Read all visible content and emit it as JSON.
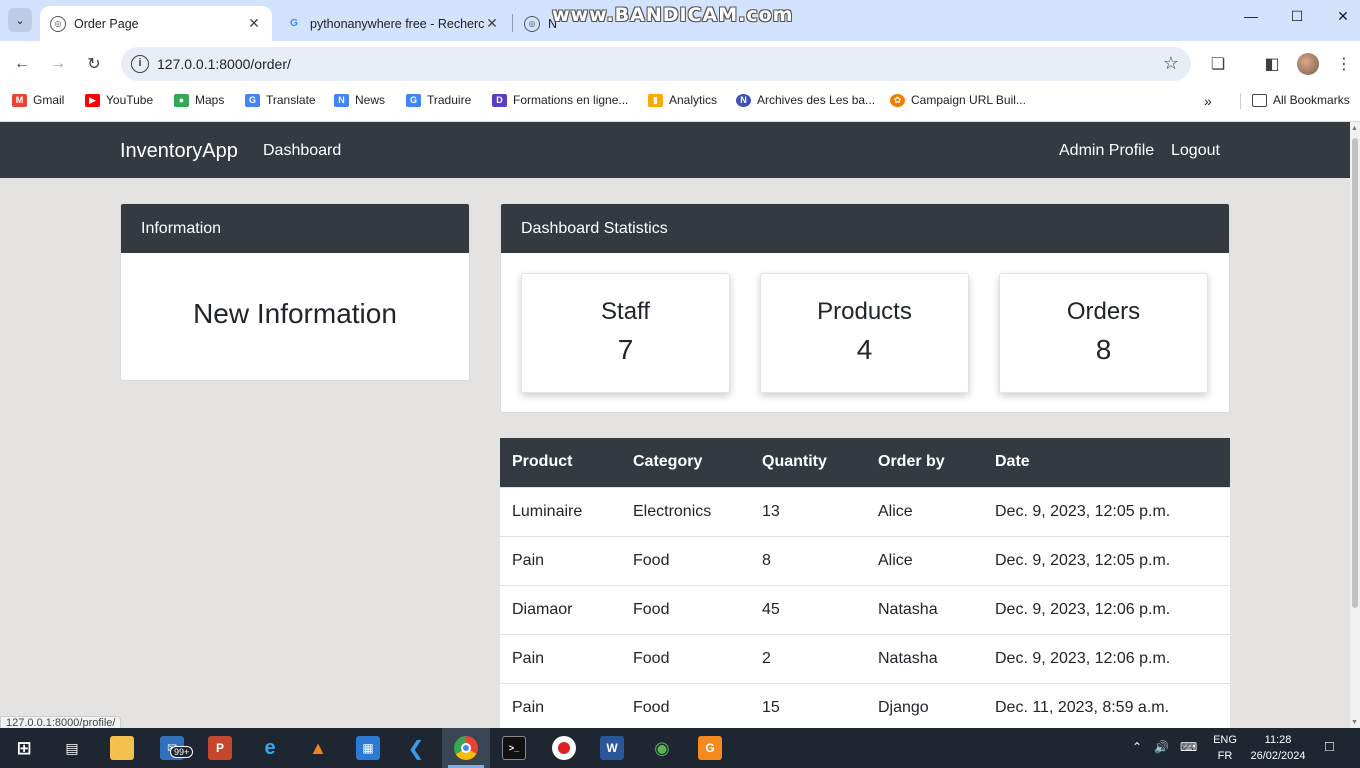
{
  "browser": {
    "tabs": [
      {
        "title": "Order Page",
        "active": true
      },
      {
        "title": "pythonanywhere free - Recherche",
        "active": false
      },
      {
        "title": "N",
        "active": false
      }
    ],
    "watermark": "www.BANDICAM.com",
    "url": "127.0.0.1:8000/order/",
    "bookmarks": [
      {
        "label": "Gmail",
        "icon": "gmail-icon",
        "color": "#ea4335"
      },
      {
        "label": "YouTube",
        "icon": "youtube-icon",
        "color": "#ff0000"
      },
      {
        "label": "Maps",
        "icon": "maps-icon",
        "color": "#34a853"
      },
      {
        "label": "Translate",
        "icon": "translate-icon",
        "color": "#4285f4"
      },
      {
        "label": "News",
        "icon": "news-icon",
        "color": "#4285f4"
      },
      {
        "label": "Traduire",
        "icon": "translate-icon",
        "color": "#4285f4"
      },
      {
        "label": "Formations en ligne...",
        "icon": "formations-icon",
        "color": "#5b3cc4"
      },
      {
        "label": "Analytics",
        "icon": "analytics-icon",
        "color": "#f9ab00"
      },
      {
        "label": "Archives des Les ba...",
        "icon": "archives-icon",
        "color": "#3f51b5"
      },
      {
        "label": "Campaign URL Buil...",
        "icon": "campaign-icon",
        "color": "#f57c00"
      }
    ],
    "all_bookmarks": "All Bookmarks",
    "status_url": "127.0.0.1:8000/profile/"
  },
  "navbar": {
    "brand": "InventoryApp",
    "dashboard": "Dashboard",
    "admin_profile": "Admin Profile",
    "logout": "Logout"
  },
  "info_card": {
    "header": "Information",
    "title": "New Information"
  },
  "stats": {
    "header": "Dashboard Statistics",
    "items": [
      {
        "label": "Staff",
        "value": "7"
      },
      {
        "label": "Products",
        "value": "4"
      },
      {
        "label": "Orders",
        "value": "8"
      }
    ]
  },
  "orders": {
    "columns": [
      "Product",
      "Category",
      "Quantity",
      "Order by",
      "Date"
    ],
    "rows": [
      [
        "Luminaire",
        "Electronics",
        "13",
        "Alice",
        "Dec. 9, 2023, 12:05 p.m."
      ],
      [
        "Pain",
        "Food",
        "8",
        "Alice",
        "Dec. 9, 2023, 12:05 p.m."
      ],
      [
        "Diamaor",
        "Food",
        "45",
        "Natasha",
        "Dec. 9, 2023, 12:06 p.m."
      ],
      [
        "Pain",
        "Food",
        "2",
        "Natasha",
        "Dec. 9, 2023, 12:06 p.m."
      ],
      [
        "Pain",
        "Food",
        "15",
        "Django",
        "Dec. 11, 2023, 8:59 a.m."
      ]
    ]
  },
  "taskbar": {
    "mail_badge": "99+",
    "lang_top": "ENG",
    "lang_bottom": "FR",
    "time": "11:28",
    "date": "26/02/2024"
  },
  "colors": {
    "navbar_bg": "#343a40",
    "page_bg": "#e5e3e1",
    "tabstrip_bg": "#d3e3fd",
    "taskbar_bg": "#1d2631"
  }
}
